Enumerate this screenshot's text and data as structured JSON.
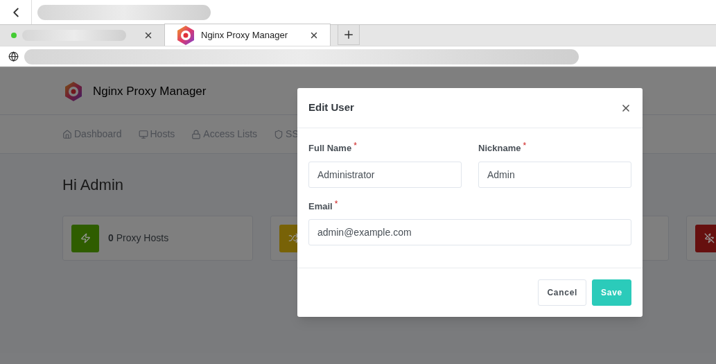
{
  "browser": {
    "tabs": [
      {
        "kind": "blurred",
        "selected": false
      },
      {
        "kind": "titled",
        "title": "Nginx Proxy Manager",
        "selected": true
      }
    ]
  },
  "app": {
    "brand": "Nginx Proxy Manager",
    "nav": [
      {
        "label": "Dashboard"
      },
      {
        "label": "Hosts"
      },
      {
        "label": "Access Lists"
      },
      {
        "label": "SS"
      }
    ],
    "greeting": "Hi Admin",
    "stats": [
      {
        "kind": "full",
        "count": "0",
        "label": "Proxy Hosts",
        "color": "#2f5d00"
      },
      {
        "kind": "covered",
        "color": "#786207"
      },
      {
        "kind": "covered"
      },
      {
        "kind": "covered",
        "color": "#66100f"
      }
    ]
  },
  "dialog": {
    "title": "Edit User",
    "rows": [
      [
        {
          "label": "Full Name",
          "required_mark": "*",
          "value": "Administrator"
        },
        {
          "label": "Nickname",
          "required_mark": "*",
          "value": "Admin"
        }
      ],
      [
        {
          "label": "Email",
          "required_mark": "*",
          "value": "admin@example.com"
        }
      ]
    ],
    "buttons": [
      {
        "label": "Cancel",
        "kind": "secondary"
      },
      {
        "label": "Save",
        "kind": "primary"
      }
    ]
  }
}
